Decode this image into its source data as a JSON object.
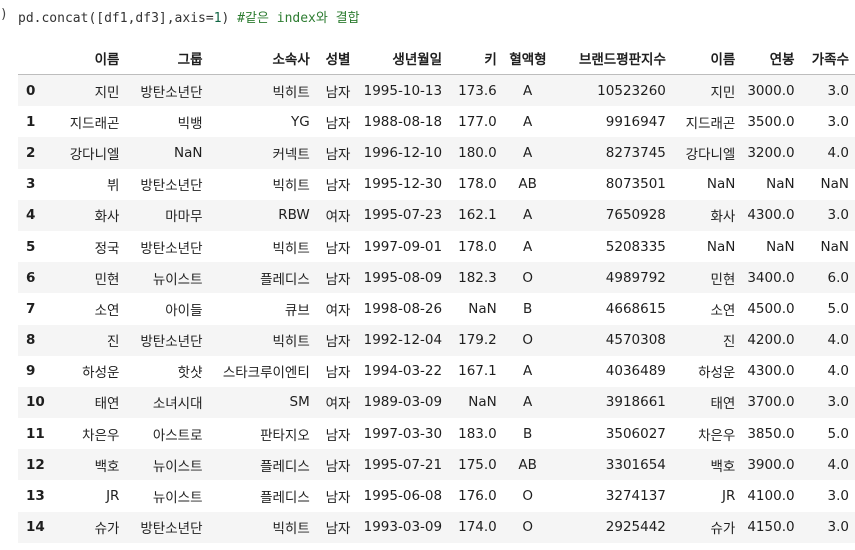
{
  "code": {
    "prompt": ")",
    "fn": "pd.concat",
    "args": "([df1,df3],axis=",
    "axis_value": "1",
    "close": ")",
    "comment": "#같은 index와 결합"
  },
  "table": {
    "columns": [
      "",
      "이름",
      "그룹",
      "소속사",
      "성별",
      "생년월일",
      "키",
      "혈액형",
      "브랜드평판지수",
      "이름",
      "연봉",
      "가족수"
    ],
    "rows": [
      [
        "0",
        "지민",
        "방탄소년단",
        "빅히트",
        "남자",
        "1995-10-13",
        "173.6",
        "A",
        "10523260",
        "지민",
        "3000.0",
        "3.0"
      ],
      [
        "1",
        "지드래곤",
        "빅뱅",
        "YG",
        "남자",
        "1988-08-18",
        "177.0",
        "A",
        "9916947",
        "지드래곤",
        "3500.0",
        "3.0"
      ],
      [
        "2",
        "강다니엘",
        "NaN",
        "커넥트",
        "남자",
        "1996-12-10",
        "180.0",
        "A",
        "8273745",
        "강다니엘",
        "3200.0",
        "4.0"
      ],
      [
        "3",
        "뷔",
        "방탄소년단",
        "빅히트",
        "남자",
        "1995-12-30",
        "178.0",
        "AB",
        "8073501",
        "NaN",
        "NaN",
        "NaN"
      ],
      [
        "4",
        "화사",
        "마마무",
        "RBW",
        "여자",
        "1995-07-23",
        "162.1",
        "A",
        "7650928",
        "화사",
        "4300.0",
        "3.0"
      ],
      [
        "5",
        "정국",
        "방탄소년단",
        "빅히트",
        "남자",
        "1997-09-01",
        "178.0",
        "A",
        "5208335",
        "NaN",
        "NaN",
        "NaN"
      ],
      [
        "6",
        "민현",
        "뉴이스트",
        "플레디스",
        "남자",
        "1995-08-09",
        "182.3",
        "O",
        "4989792",
        "민현",
        "3400.0",
        "6.0"
      ],
      [
        "7",
        "소연",
        "아이들",
        "큐브",
        "여자",
        "1998-08-26",
        "NaN",
        "B",
        "4668615",
        "소연",
        "4500.0",
        "5.0"
      ],
      [
        "8",
        "진",
        "방탄소년단",
        "빅히트",
        "남자",
        "1992-12-04",
        "179.2",
        "O",
        "4570308",
        "진",
        "4200.0",
        "4.0"
      ],
      [
        "9",
        "하성운",
        "핫샷",
        "스타크루이엔티",
        "남자",
        "1994-03-22",
        "167.1",
        "A",
        "4036489",
        "하성운",
        "4300.0",
        "4.0"
      ],
      [
        "10",
        "태연",
        "소녀시대",
        "SM",
        "여자",
        "1989-03-09",
        "NaN",
        "A",
        "3918661",
        "태연",
        "3700.0",
        "3.0"
      ],
      [
        "11",
        "차은우",
        "아스트로",
        "판타지오",
        "남자",
        "1997-03-30",
        "183.0",
        "B",
        "3506027",
        "차은우",
        "3850.0",
        "5.0"
      ],
      [
        "12",
        "백호",
        "뉴이스트",
        "플레디스",
        "남자",
        "1995-07-21",
        "175.0",
        "AB",
        "3301654",
        "백호",
        "3900.0",
        "4.0"
      ],
      [
        "13",
        "JR",
        "뉴이스트",
        "플레디스",
        "남자",
        "1995-06-08",
        "176.0",
        "O",
        "3274137",
        "JR",
        "4100.0",
        "3.0"
      ],
      [
        "14",
        "슈가",
        "방탄소년단",
        "빅히트",
        "남자",
        "1993-03-09",
        "174.0",
        "O",
        "2925442",
        "슈가",
        "4150.0",
        "3.0"
      ]
    ]
  }
}
